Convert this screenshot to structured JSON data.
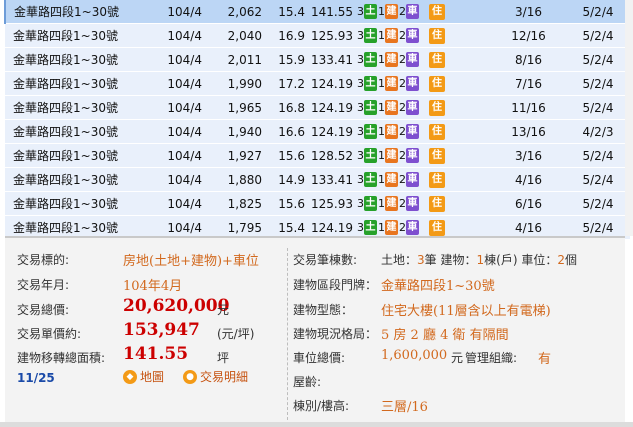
{
  "columns": [
    "address",
    "year_month",
    "total_price",
    "unit_price",
    "area",
    "land",
    "building",
    "parking",
    "usage",
    "floor",
    "completion"
  ],
  "rows": [
    {
      "address": "金華路四段1~30號",
      "ym": "104/4",
      "total": "2,062",
      "unit": "15.4",
      "area": "141.55",
      "land": "3",
      "bld": "1",
      "car": "2",
      "floor": "3/16",
      "date": "5/2/4",
      "selected": true
    },
    {
      "address": "金華路四段1~30號",
      "ym": "104/4",
      "total": "2,040",
      "unit": "16.9",
      "area": "125.93",
      "land": "3",
      "bld": "1",
      "car": "2",
      "floor": "12/16",
      "date": "5/2/4",
      "selected": false
    },
    {
      "address": "金華路四段1~30號",
      "ym": "104/4",
      "total": "2,011",
      "unit": "15.9",
      "area": "133.41",
      "land": "3",
      "bld": "1",
      "car": "2",
      "floor": "8/16",
      "date": "5/2/4",
      "selected": false
    },
    {
      "address": "金華路四段1~30號",
      "ym": "104/4",
      "total": "1,990",
      "unit": "17.2",
      "area": "124.19",
      "land": "3",
      "bld": "1",
      "car": "2",
      "floor": "7/16",
      "date": "5/2/4",
      "selected": false
    },
    {
      "address": "金華路四段1~30號",
      "ym": "104/4",
      "total": "1,965",
      "unit": "16.8",
      "area": "124.19",
      "land": "3",
      "bld": "1",
      "car": "2",
      "floor": "11/16",
      "date": "5/2/4",
      "selected": false
    },
    {
      "address": "金華路四段1~30號",
      "ym": "104/4",
      "total": "1,940",
      "unit": "16.6",
      "area": "124.19",
      "land": "3",
      "bld": "1",
      "car": "2",
      "floor": "13/16",
      "date": "4/2/3",
      "selected": false
    },
    {
      "address": "金華路四段1~30號",
      "ym": "104/4",
      "total": "1,927",
      "unit": "15.6",
      "area": "128.52",
      "land": "3",
      "bld": "1",
      "car": "2",
      "floor": "3/16",
      "date": "5/2/4",
      "selected": false
    },
    {
      "address": "金華路四段1~30號",
      "ym": "104/4",
      "total": "1,880",
      "unit": "14.9",
      "area": "133.41",
      "land": "3",
      "bld": "1",
      "car": "2",
      "floor": "4/16",
      "date": "5/2/4",
      "selected": false
    },
    {
      "address": "金華路四段1~30號",
      "ym": "104/4",
      "total": "1,825",
      "unit": "15.6",
      "area": "125.93",
      "land": "3",
      "bld": "1",
      "car": "2",
      "floor": "6/16",
      "date": "5/2/4",
      "selected": false
    },
    {
      "address": "金華路四段1~30號",
      "ym": "104/4",
      "total": "1,795",
      "unit": "15.4",
      "area": "124.19",
      "land": "3",
      "bld": "1",
      "car": "2",
      "floor": "4/16",
      "date": "5/2/4",
      "selected": false
    }
  ],
  "badges": {
    "land": "土",
    "bld": "建",
    "car": "車",
    "use": "住"
  },
  "detail": {
    "target_label": "交易標的:",
    "target_value": "房地(土地+建物)+車位",
    "ym_label": "交易年月:",
    "ym_value": "104年4月",
    "total_label": "交易總價:",
    "total_value": "20,620,000",
    "total_unit": "元",
    "unit_label": "交易單價約:",
    "unit_value": "153,947",
    "unit_unit": "(元/坪)",
    "area_label": "建物移轉總面積:",
    "area_value": "141.55",
    "area_unit": "坪",
    "date_code": "11/25",
    "map_btn": "地圖",
    "detail_btn": "交易明細",
    "count_label": "交易筆棟數:",
    "count_land_label": "土地：",
    "count_land": "3",
    "count_land_unit": "筆",
    "count_bld_label": "建物：",
    "count_bld": "1",
    "count_bld_unit": "棟(戶)",
    "count_car_label": "車位：",
    "count_car": "2",
    "count_car_unit": "個",
    "addr_label": "建物區段門牌：",
    "addr_value": "金華路四段1~30號",
    "type_label": "建物型態：",
    "type_value": "住宅大樓(11層含以上有電梯)",
    "layout_label": "建物現況格局：",
    "layout_value": "5 房 2 廳 4 衛 有隔間",
    "car_total_label": "車位總價:",
    "car_total_value": "1,600,000",
    "car_total_unit": "元",
    "mgmt_label": "管理組織:",
    "mgmt_value": "有",
    "age_label": "屋齡:",
    "floor_label": "棟別/樓高:",
    "floor_value": "三層/16"
  }
}
